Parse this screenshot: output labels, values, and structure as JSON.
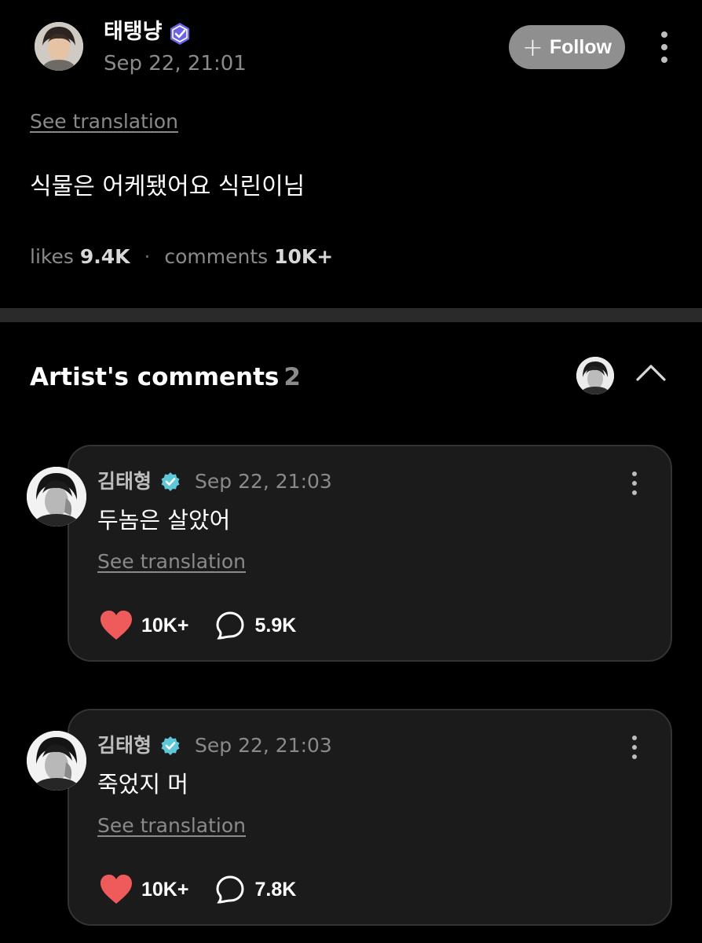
{
  "post": {
    "author_name": "태탱냥",
    "timestamp": "Sep 22, 21:01",
    "follow_label": "Follow",
    "see_translation": "See translation",
    "body": "식물은 어케됐어요 식린이님",
    "likes_label": "likes",
    "likes_count": "9.4K",
    "comments_label": "comments",
    "comments_count": "10K+"
  },
  "artist_comments": {
    "title": "Artist's comments",
    "count": "2",
    "items": [
      {
        "author_name": "김태형",
        "timestamp": "Sep 22, 21:03",
        "body": "두놈은 살았어",
        "see_translation": "See translation",
        "likes": "10K+",
        "replies": "5.9K"
      },
      {
        "author_name": "김태형",
        "timestamp": "Sep 22, 21:03",
        "body": "죽었지 머",
        "see_translation": "See translation",
        "likes": "10K+",
        "replies": "7.8K"
      }
    ]
  },
  "icons": {
    "follow": "plus-icon",
    "menu": "more-vertical-icon",
    "collapse": "chevron-up-icon",
    "like": "heart-icon",
    "reply": "speech-bubble-icon",
    "verified": "verified-badge-icon"
  },
  "colors": {
    "background": "#000000",
    "card": "#1b1b1b",
    "heart": "#ef5b5b",
    "verified_artist": "#5ec8d8",
    "verified_fan": "#6c63e8",
    "follow_button": "#8f8f8f",
    "muted_text": "#8a8a8a"
  }
}
